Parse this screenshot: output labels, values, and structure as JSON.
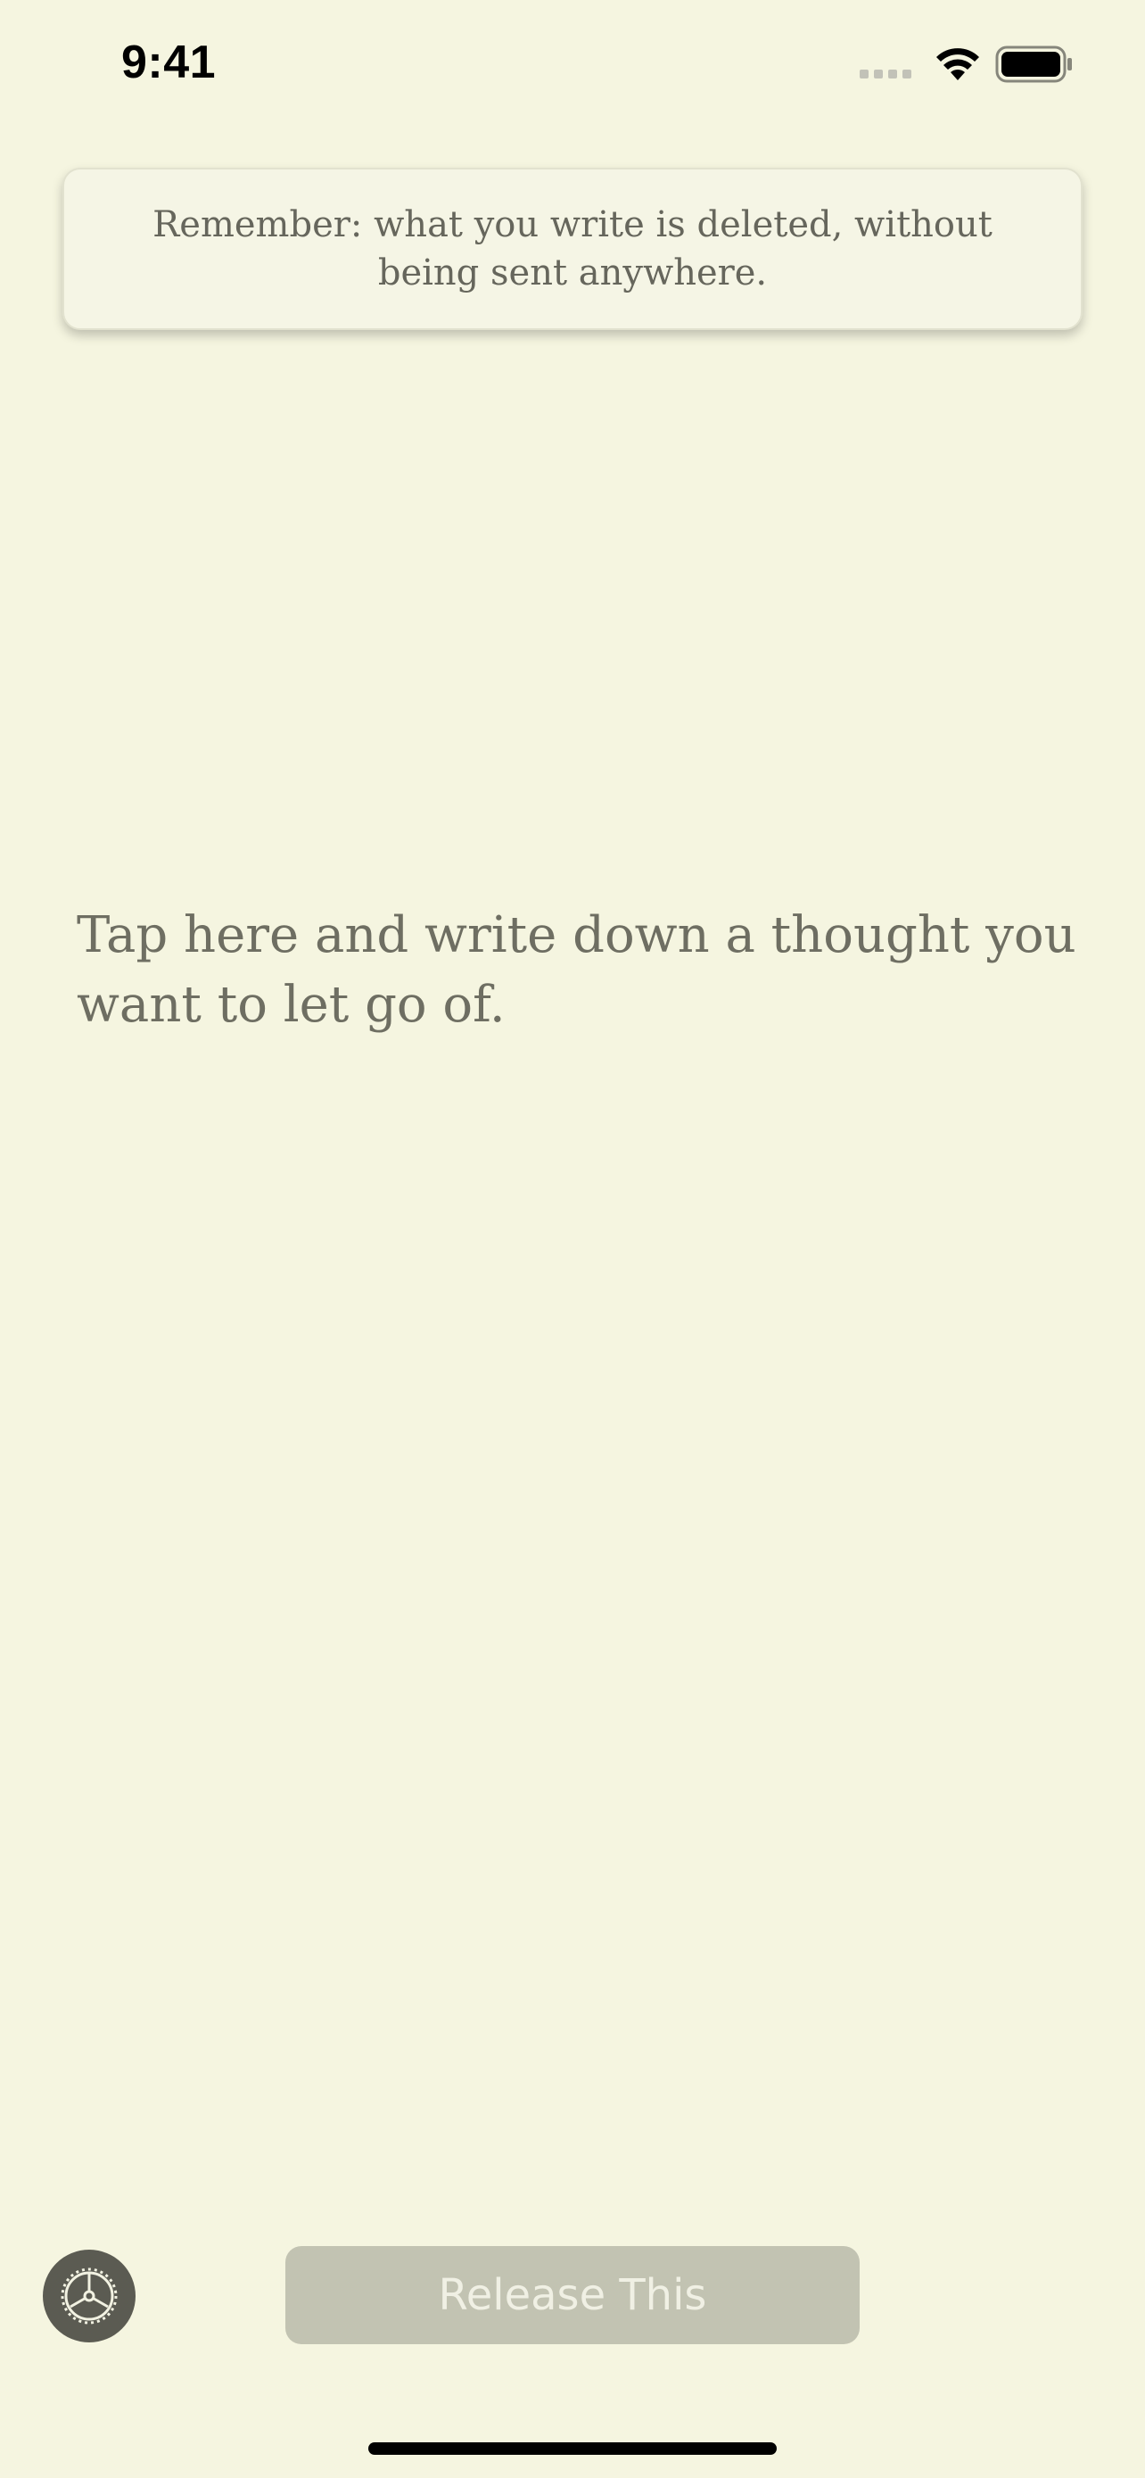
{
  "status_bar": {
    "time": "9:41",
    "icons": [
      "cellular-signal-icon",
      "wifi-icon",
      "battery-icon"
    ]
  },
  "notice": {
    "text": "Remember: what you write is deleted, without being sent anywhere."
  },
  "editor": {
    "placeholder": "Tap here and write down a thought you want to let go of.",
    "value": ""
  },
  "controls": {
    "settings_icon": "gear-icon",
    "release_label": "Release This",
    "release_enabled": false
  },
  "colors": {
    "background": "#f5f5e0",
    "text_muted": "#6e6e62",
    "button_disabled": "#c2c3b2",
    "settings_button": "#5b5b52"
  }
}
